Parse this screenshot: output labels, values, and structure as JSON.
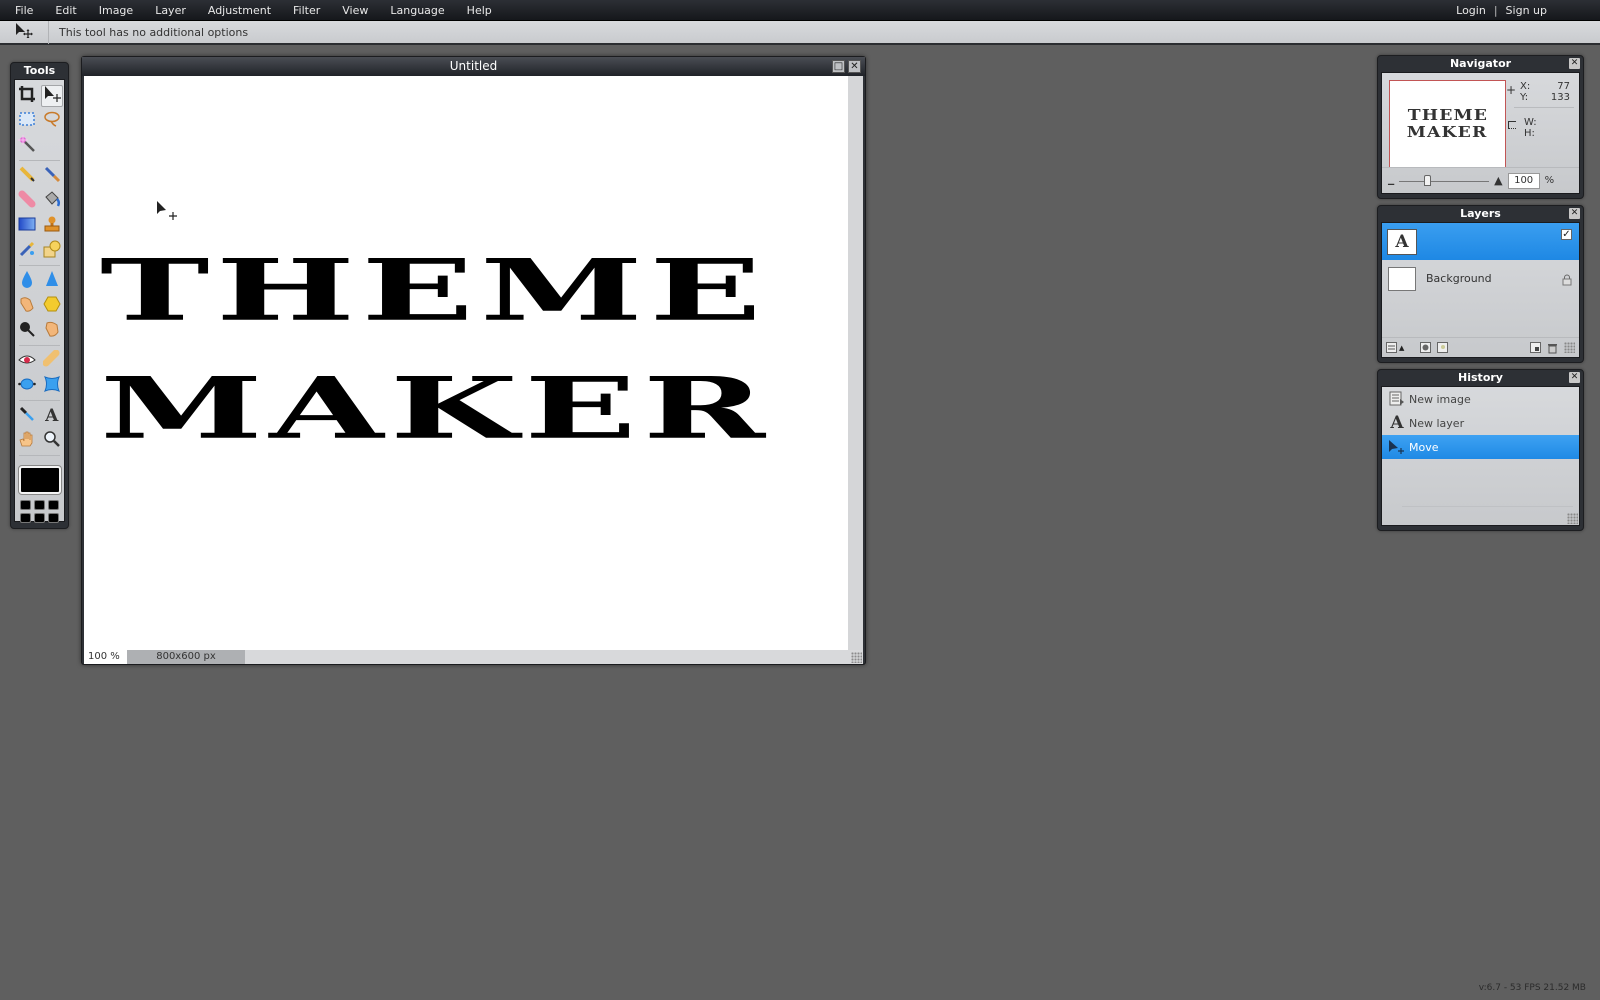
{
  "menubar": {
    "items": [
      "File",
      "Edit",
      "Image",
      "Layer",
      "Adjustment",
      "Filter",
      "View",
      "Language",
      "Help"
    ],
    "login": "Login",
    "separator": "|",
    "signup": "Sign up"
  },
  "options_bar": {
    "current_tool_icon": "move-tool-icon",
    "message": "This tool has no additional options"
  },
  "tools_panel": {
    "title": "Tools",
    "active_tool": "move",
    "tools": [
      [
        "crop",
        "move"
      ],
      [
        "marquee",
        "lasso"
      ],
      [
        "magic-wand"
      ],
      [
        "pencil",
        "brush"
      ],
      [
        "eraser",
        "paint-bucket"
      ],
      [
        "gradient",
        "clone-stamp"
      ],
      [
        "color-replace",
        "shape"
      ],
      [
        "blur",
        "sharpen"
      ],
      [
        "smudge",
        "sponge"
      ],
      [
        "dodge",
        "burn"
      ],
      [
        "red-eye",
        "spot-heal"
      ],
      [
        "bloat",
        "pinch"
      ],
      [
        "color-picker",
        "text"
      ],
      [
        "hand",
        "zoom"
      ]
    ],
    "foreground_color": "#000000"
  },
  "document": {
    "title": "Untitled",
    "canvas_text_line1": "THEME",
    "canvas_text_line2": "MAKER",
    "zoom": "100",
    "zoom_unit": "%",
    "dimensions": "800x600 px"
  },
  "navigator": {
    "title": "Navigator",
    "thumb_line1": "THEME",
    "thumb_line2": "MAKER",
    "x_label": "X:",
    "x_value": "77",
    "y_label": "Y:",
    "y_value": "133",
    "w_label": "W:",
    "h_label": "H:",
    "zoom_value": "100",
    "zoom_unit": "%",
    "zoom_slider_fraction": 0.3
  },
  "layers": {
    "title": "Layers",
    "items": [
      {
        "name": "",
        "thumb": "A",
        "selected": true,
        "visible": true
      },
      {
        "name": "Background",
        "thumb": "",
        "selected": false,
        "locked": true
      }
    ]
  },
  "history": {
    "title": "History",
    "items": [
      {
        "label": "New image",
        "icon": "new-image-icon"
      },
      {
        "label": "New layer",
        "icon": "text-layer-icon"
      },
      {
        "label": "Move",
        "icon": "move-tool-icon",
        "selected": true
      }
    ]
  },
  "status": {
    "version": "v:6.7 - 53 FPS 21.52 MB"
  },
  "colors": {
    "accent": "#1e88e4",
    "background": "#5f5f5f",
    "menubar": "#1b1d21"
  }
}
